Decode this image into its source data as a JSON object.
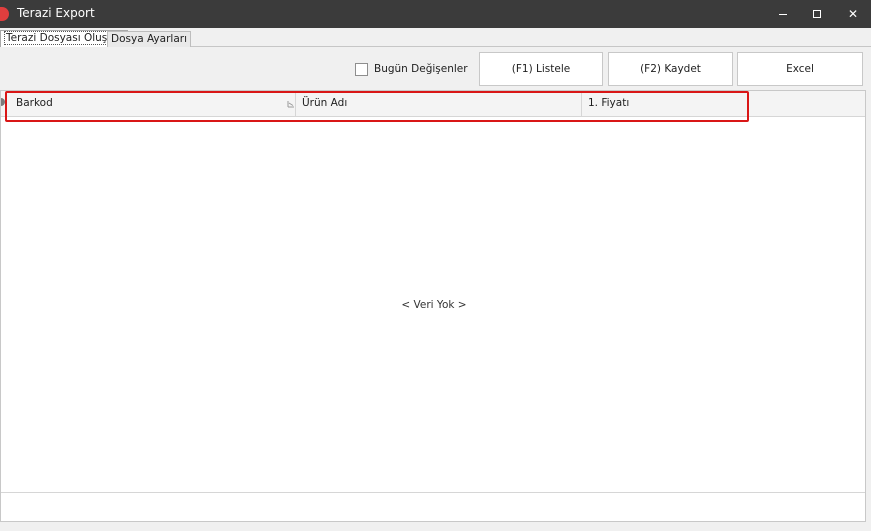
{
  "window": {
    "title": "Terazi Export",
    "accent_color": "#e03e3e",
    "titlebar_color": "#3b3b3b",
    "controls": {
      "minimize_icon": "minimize-icon",
      "maximize_icon": "maximize-icon",
      "close_glyph": "✕"
    }
  },
  "tabs": [
    {
      "label": "Terazi Dosyası Oluştur",
      "active": true
    },
    {
      "label": "Dosya Ayarları",
      "active": false
    }
  ],
  "toolbar": {
    "checkbox_label": "Bugün Değişenler",
    "checkbox_checked": false,
    "listele_label": "(F1) Listele",
    "kaydet_label": "(F2) Kaydet",
    "excel_label": "Excel"
  },
  "grid": {
    "columns": [
      "Barkod",
      "Ürün Adı",
      "1. Fiyatı"
    ],
    "empty_message": "< Veri Yok >",
    "highlight_color": "#d91616"
  }
}
